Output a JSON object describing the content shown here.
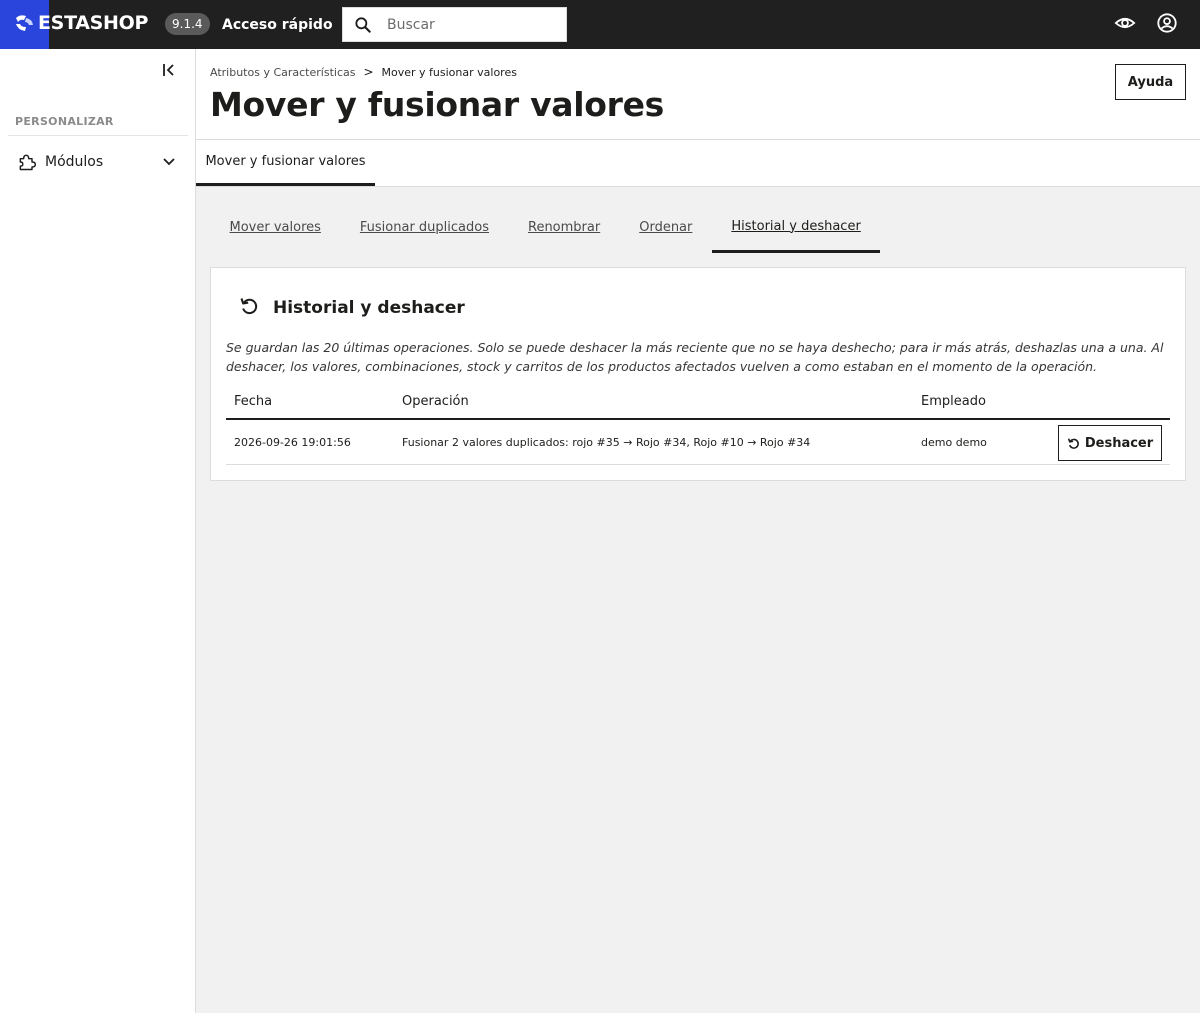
{
  "header": {
    "logo_text": "PRESTASHOP",
    "logo_text_visible": "ESTASHOP",
    "version": "9.1.4",
    "quick_access_label": "Acceso rápido",
    "search_placeholder": "Buscar",
    "search_value": ""
  },
  "sidebar": {
    "section_title": "PERSONALIZAR",
    "items": [
      {
        "label": "Módulos",
        "icon": "puzzle-icon",
        "expandable": true
      }
    ]
  },
  "page": {
    "breadcrumb": [
      "Atributos y Características",
      "Mover y fusionar valores"
    ],
    "breadcrumb_separator": ">",
    "title": "Mover y fusionar valores",
    "help_label": "Ayuda",
    "tabs": [
      {
        "label": "Mover y fusionar valores",
        "active": true
      }
    ]
  },
  "sub_tabs": [
    {
      "label": "Mover valores",
      "active": false
    },
    {
      "label": "Fusionar duplicados",
      "active": false
    },
    {
      "label": "Renombrar",
      "active": false
    },
    {
      "label": "Ordenar",
      "active": false
    },
    {
      "label": "Historial y deshacer",
      "active": true
    }
  ],
  "history_card": {
    "title": "Historial y deshacer",
    "description": "Se guardan las 20 últimas operaciones. Solo se puede deshacer la más reciente que no se haya deshecho; para ir más atrás, deshazlas una a una. Al deshacer, los valores, combinaciones, stock y carritos de los productos afectados vuelven a como estaban en el momento de la operación.",
    "columns": [
      "Fecha",
      "Operación",
      "Empleado"
    ],
    "rows": [
      {
        "date": "2026-09-26 19:01:56",
        "operation": "Fusionar 2 valores duplicados: rojo #35 → Rojo #34, Rojo #10 → Rojo #34",
        "employee": "demo demo",
        "action_label": "Deshacer"
      }
    ]
  },
  "colors": {
    "topbar": "#202020",
    "brand_blue": "#2a45dc",
    "text": "#1d1d1b",
    "background": "#f1f1f1"
  }
}
